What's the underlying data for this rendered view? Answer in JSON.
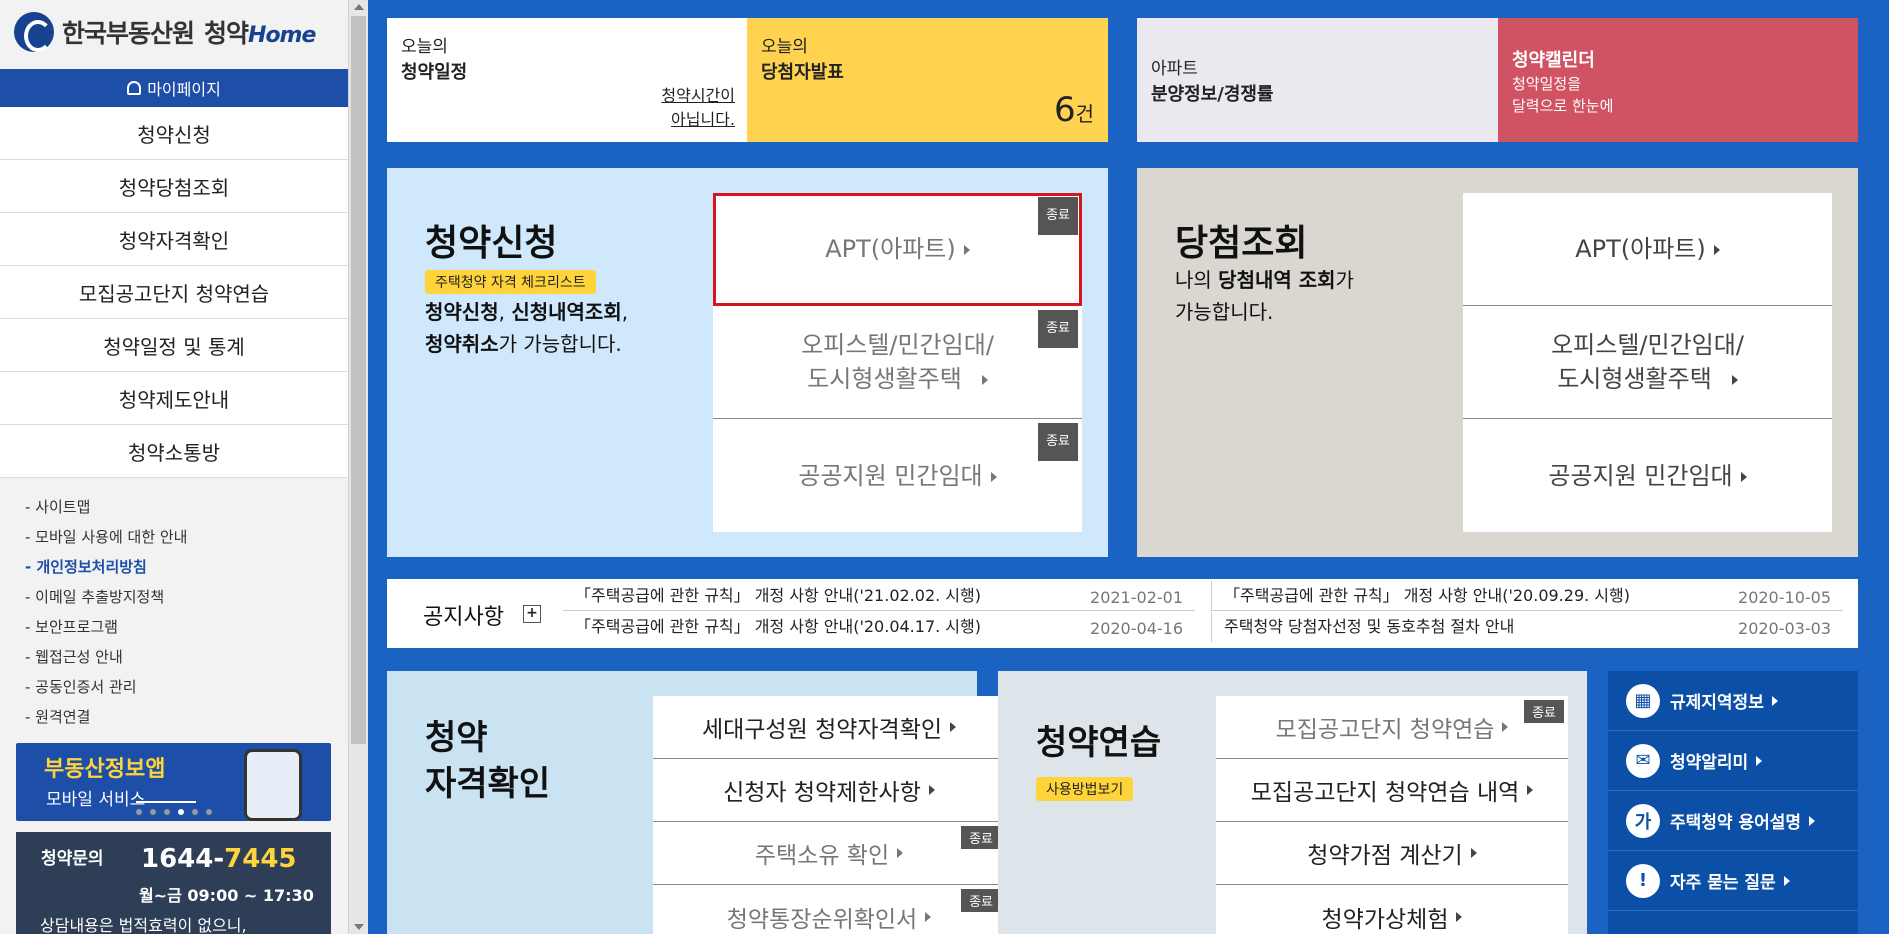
{
  "logo": {
    "org": "한국부동산원",
    "brand": "청약",
    "home": "Home"
  },
  "sidebar": {
    "mypage": "마이페이지",
    "nav": [
      "청약신청",
      "청약당첨조회",
      "청약자격확인",
      "모집공고단지 청약연습",
      "청약일정 및 통계",
      "청약제도안내",
      "청약소통방"
    ],
    "links": [
      "- 사이트맵",
      "- 모바일 사용에 대한 안내",
      "- 개인정보처리방침",
      "- 이메일 추출방지정책",
      "- 보안프로그램",
      "- 웹접근성 안내",
      "- 공동인증서 관리",
      "- 원격연결"
    ],
    "banner": {
      "title": "부동산정보앱",
      "subtitle": "모바일 서비스"
    },
    "contact": {
      "label": "청약문의",
      "num_a": "1644-",
      "num_b": "7445",
      "hours": "월~금 09:00 ~ 17:30",
      "note": "상담내용은 법적효력이 없으니,"
    }
  },
  "top": {
    "schedule": {
      "sub": "오늘의",
      "main": "청약일정",
      "note1": "청약시간이",
      "note2": "아닙니다."
    },
    "winners": {
      "sub": "오늘의",
      "main": "당첨자발표",
      "count": "6",
      "unit": "건"
    },
    "apt": {
      "sub": "아파트",
      "main": "분양정보/경쟁률"
    },
    "calendar": {
      "main": "청약캘린더",
      "desc1": "청약일정을",
      "desc2": "달력으로 한눈에"
    }
  },
  "apply": {
    "title": "청약신청",
    "pill": "주택청약 자격 체크리스트",
    "desc1_b1": "청약신청",
    "desc1_t1": ", ",
    "desc1_b2": "신청내역조회",
    "desc1_t2": ",",
    "desc2_b": "청약취소",
    "desc2_t": "가 가능합니다.",
    "buttons": [
      {
        "line1": "APT(아파트)",
        "badge": "종료"
      },
      {
        "line1": "오피스텔/민간임대/",
        "line2": "도시형생활주택",
        "badge": "종료"
      },
      {
        "line1": "공공지원 민간임대",
        "badge": "종료"
      }
    ]
  },
  "winning": {
    "title": "당첨조회",
    "desc1_t1": "나의 ",
    "desc1_b": "당첨내역 조회",
    "desc1_t2": "가",
    "desc2": "가능합니다.",
    "buttons": [
      {
        "line1": "APT(아파트)"
      },
      {
        "line1": "오피스텔/민간임대/",
        "line2": "도시형생활주택"
      },
      {
        "line1": "공공지원 민간임대"
      }
    ]
  },
  "notice": {
    "title": "공지사항",
    "plus": "+",
    "items": [
      {
        "text": "「주택공급에 관한 규칙」 개정 사항 안내('21.02.02. 시행)",
        "date": "2021-02-01"
      },
      {
        "text": "「주택공급에 관한 규칙」 개정 사항 안내('20.09.29. 시행)",
        "date": "2020-10-05"
      },
      {
        "text": "「주택공급에 관한 규칙」 개정 사항 안내('20.04.17. 시행)",
        "date": "2020-04-16"
      },
      {
        "text": "주택청약 당첨자선정 및 동호추첨 절차 안내",
        "date": "2020-03-03"
      }
    ]
  },
  "qualification": {
    "title1": "청약",
    "title2": "자격확인",
    "buttons": [
      {
        "label": "세대구성원 청약자격확인"
      },
      {
        "label": "신청자 청약제한사항"
      },
      {
        "label": "주택소유 확인",
        "badge": "종료"
      },
      {
        "label": "청약통장순위확인서",
        "badge": "종료"
      }
    ]
  },
  "practice": {
    "title": "청약연습",
    "pill": "사용방법보기",
    "buttons": [
      {
        "label": "모집공고단지 청약연습",
        "badge": "종료"
      },
      {
        "label": "모집공고단지 청약연습 내역"
      },
      {
        "label": "청약가점 계산기"
      },
      {
        "label": "청약가상체험"
      }
    ]
  },
  "quick_links": [
    {
      "label": "규제지역정보",
      "icon": "building-icon",
      "glyph": "▦"
    },
    {
      "label": "청약알리미",
      "icon": "mail-icon",
      "glyph": "✉"
    },
    {
      "label": "주택청약 용어설명",
      "icon": "glossary-icon",
      "glyph": "가"
    },
    {
      "label": "자주 묻는 질문",
      "icon": "faq-icon",
      "glyph": "!"
    }
  ]
}
